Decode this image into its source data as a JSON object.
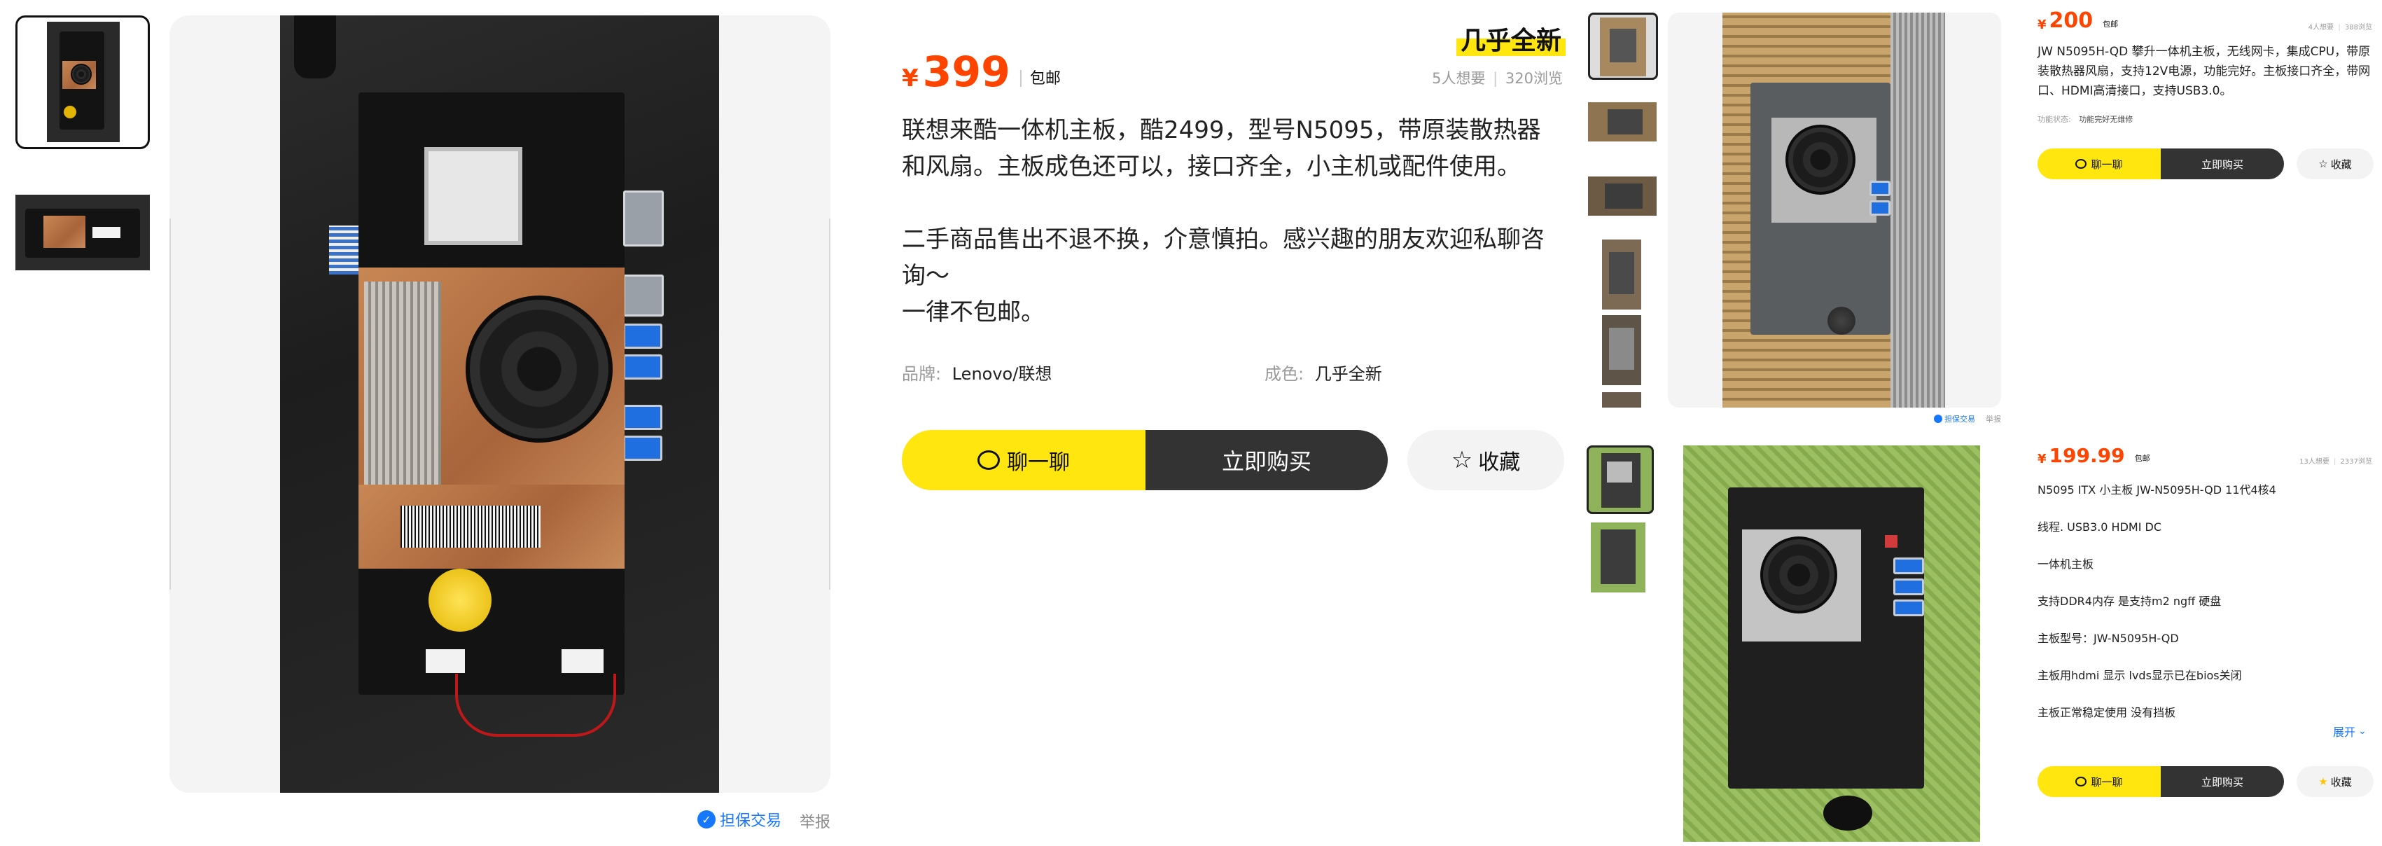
{
  "left_panel": {
    "main_price_symbol": "¥",
    "main_price": "399",
    "shipping": "包邮",
    "condition_badge": "几乎全新",
    "wants": "5人想要",
    "views": "320浏览",
    "description": [
      "联想来酷一体机主板，酷2499，型号N5095，带原装散热器",
      "和风扇。主板成色还可以，接口齐全，小主机或配件使用。",
      "",
      "二手商品售出不退不换，介意慎拍。感兴趣的朋友欢迎私聊咨",
      "询～",
      "一律不包邮。"
    ],
    "attr_brand_label": "品牌:",
    "attr_brand_value": "Lenovo/联想",
    "attr_condition_label": "成色:",
    "attr_condition_value": "几乎全新",
    "chat_label": "聊一聊",
    "buy_label": "立即购买",
    "fav_label": "收藏",
    "guarantee_label": "担保交易",
    "report_label": "举报"
  },
  "right_top": {
    "price_symbol": "¥",
    "price": "200",
    "shipping": "包邮",
    "wants": "4人想要",
    "views": "388浏览",
    "description": "JW N5095H-QD 攀升一体机主板，无线网卡，集成CPU，带原装散热器风扇，支持12V电源，功能完好。主板接口齐全，带网口、HDMI高清接口，支持USB3.0。",
    "func_label": "功能状态:",
    "func_value": "功能完好无维修",
    "chat_label": "聊一聊",
    "buy_label": "立即购买",
    "fav_label": "收藏",
    "guarantee_label": "担保交易",
    "report_label": "举报"
  },
  "right_bottom": {
    "price_symbol": "¥",
    "price": "199.99",
    "shipping": "包邮",
    "wants": "13人想要",
    "views": "2337浏览",
    "lines": [
      "N5095 ITX 小主板 JW-N5095H-QD 11代4核4",
      "线程. USB3.0 HDMI DC",
      "一体机主板",
      "支持DDR4内存 是支持m2 ngff 硬盘",
      "主板型号：JW-N5095H-QD",
      "主板用hdmi 显示 lvds显示已在bios关闭",
      "主板正常稳定使用 没有挡板"
    ],
    "expand_label": "展开",
    "chat_label": "聊一聊",
    "buy_label": "立即购买",
    "fav_label": "收藏"
  },
  "colors": {
    "accent_yellow": "#ffe60f",
    "price_orange": "#ff4400",
    "dark_button": "#333333",
    "link_blue": "#1677ff"
  }
}
